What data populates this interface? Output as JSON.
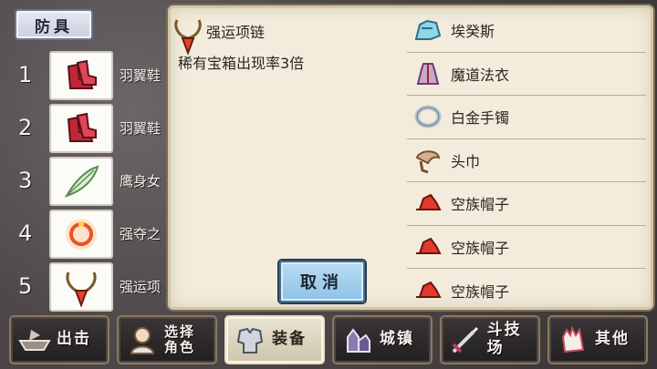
{
  "category_tab": "防具",
  "slots": [
    {
      "num": "1",
      "name": "羽翼鞋",
      "icon": "red-boots-icon"
    },
    {
      "num": "2",
      "name": "羽翼鞋",
      "icon": "red-boots-icon"
    },
    {
      "num": "3",
      "name": "鹰身女",
      "icon": "feather-icon"
    },
    {
      "num": "4",
      "name": "强夺之",
      "icon": "ring-icon"
    },
    {
      "num": "5",
      "name": "强运项",
      "icon": "necklace-icon"
    }
  ],
  "detail": {
    "title": "强运项链",
    "description": "稀有宝箱出现率3倍",
    "icon": "necklace-icon"
  },
  "cancel_label": "取消",
  "items": [
    {
      "label": "埃癸斯",
      "icon": "aegis-icon"
    },
    {
      "label": "魔道法衣",
      "icon": "robe-icon"
    },
    {
      "label": "白金手镯",
      "icon": "bracelet-icon"
    },
    {
      "label": "头巾",
      "icon": "turban-icon"
    },
    {
      "label": "空族帽子",
      "icon": "red-hat-icon"
    },
    {
      "label": "空族帽子",
      "icon": "red-hat-icon"
    },
    {
      "label": "空族帽子",
      "icon": "red-hat-icon"
    }
  ],
  "nav": [
    {
      "label": "出击",
      "icon": "ship-icon"
    },
    {
      "label": "选择\n角色",
      "icon": "character-icon"
    },
    {
      "label": "装备",
      "icon": "armor-icon"
    },
    {
      "label": "城镇",
      "icon": "town-icon"
    },
    {
      "label": "斗技场",
      "icon": "sword-icon"
    },
    {
      "label": "其他",
      "icon": "glove-icon"
    }
  ],
  "colors": {
    "parchment": "#f3ecdd",
    "cancel_button": "#8ec2e6",
    "nav_active": "#e9e3d2"
  }
}
